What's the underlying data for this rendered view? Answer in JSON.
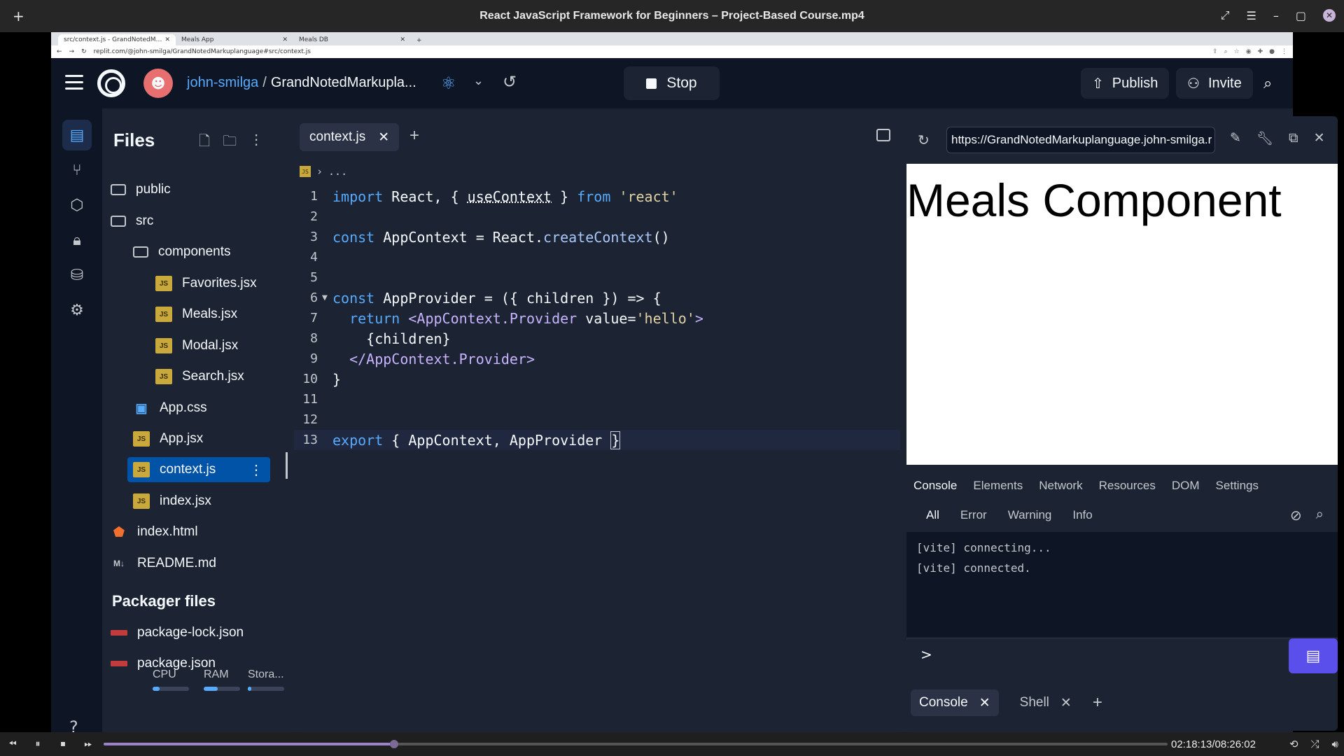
{
  "player": {
    "title": "React JavaScript Framework for Beginners – Project-Based Course.mp4",
    "timecode": "02:18:13/08:26:02",
    "progress_fraction": 0.273
  },
  "browser": {
    "tabs": [
      {
        "label": "src/context.js - GrandNotedM…"
      },
      {
        "label": "Meals App"
      },
      {
        "label": "Meals DB"
      }
    ],
    "url": "replit.com/@john-smilga/GrandNotedMarkuplanguage#src/context.js"
  },
  "header": {
    "user": "john-smilga",
    "separator": "/",
    "repl_name": "GrandNotedMarkupla...",
    "stop_label": "Stop",
    "publish_label": "Publish",
    "invite_label": "Invite"
  },
  "files": {
    "title": "Files",
    "items": [
      {
        "label": "public",
        "icon": "folder-icon"
      },
      {
        "label": "src",
        "icon": "folder-icon"
      },
      {
        "label": "components",
        "icon": "folder-icon"
      },
      {
        "label": "Favorites.jsx",
        "icon": "js-file-icon"
      },
      {
        "label": "Meals.jsx",
        "icon": "js-file-icon"
      },
      {
        "label": "Modal.jsx",
        "icon": "js-file-icon"
      },
      {
        "label": "Search.jsx",
        "icon": "js-file-icon"
      },
      {
        "label": "App.css",
        "icon": "css-file-icon"
      },
      {
        "label": "App.jsx",
        "icon": "js-file-icon"
      },
      {
        "label": "context.js",
        "icon": "js-file-icon"
      },
      {
        "label": "index.jsx",
        "icon": "js-file-icon"
      },
      {
        "label": "index.html",
        "icon": "html-file-icon"
      },
      {
        "label": "README.md",
        "icon": "markdown-file-icon"
      }
    ],
    "packager_title": "Packager files",
    "packager_items": [
      {
        "label": "package-lock.json",
        "icon": "package-icon"
      },
      {
        "label": "package.json",
        "icon": "package-icon"
      }
    ],
    "resources": [
      {
        "label": "CPU",
        "level": 0.2
      },
      {
        "label": "RAM",
        "level": 0.38
      },
      {
        "label": "Stora...",
        "level": 0.1
      }
    ]
  },
  "editor": {
    "tab_label": "context.js",
    "breadcrumb": "...",
    "code": [
      {
        "n": "1",
        "text": "import React, { useContext } from 'react'"
      },
      {
        "n": "2",
        "text": ""
      },
      {
        "n": "3",
        "text": "const AppContext = React.createContext()"
      },
      {
        "n": "4",
        "text": ""
      },
      {
        "n": "5",
        "text": ""
      },
      {
        "n": "6",
        "text": "const AppProvider = ({ children }) => {"
      },
      {
        "n": "7",
        "text": "  return <AppContext.Provider value='hello'>"
      },
      {
        "n": "8",
        "text": "    {children}"
      },
      {
        "n": "9",
        "text": "  </AppContext.Provider>"
      },
      {
        "n": "10",
        "text": "}"
      },
      {
        "n": "11",
        "text": ""
      },
      {
        "n": "12",
        "text": ""
      },
      {
        "n": "13",
        "text": "export { AppContext, AppProvider }"
      }
    ]
  },
  "webview": {
    "url": "https://GrandNotedMarkuplanguage.john-smilga.r",
    "heading": "Meals Component"
  },
  "devtools": {
    "tabs": [
      "Console",
      "Elements",
      "Network",
      "Resources",
      "DOM",
      "Settings"
    ],
    "filters": [
      "All",
      "Error",
      "Warning",
      "Info"
    ],
    "logs": [
      "[vite] connecting...",
      "[vite] connected."
    ],
    "prompt": ">"
  },
  "bottom_tabs": [
    {
      "label": "Console"
    },
    {
      "label": "Shell"
    }
  ],
  "colors": {
    "background": "#0e1525",
    "panel": "#1c2333",
    "accent": "#57abff",
    "selected": "#0053a6",
    "chat_button": "#5a4fea"
  }
}
